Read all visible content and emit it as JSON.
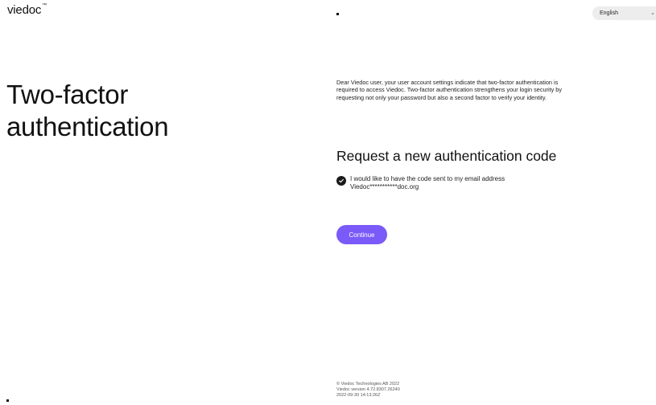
{
  "header": {
    "logo": "viedoc",
    "logo_tm": "™",
    "language": "English",
    "language_chevron": "⌄"
  },
  "hero": {
    "title_line1": "Two-factor",
    "title_line2": "authentication"
  },
  "main": {
    "intro": "Dear Viedoc user, your user account settings indicate that two-factor authentication is required to access Viedoc. Two-factor authentication strengthens your login security by requesting not only your password but also a second factor to verify your identity.",
    "heading": "Request a new authentication code",
    "option_label": "I would like to have the code sent to my email address",
    "option_email": "Viedoc***********doc.org",
    "continue_label": "Continue"
  },
  "footer": {
    "copyright": "© Viedoc Technologies AB 2022",
    "version": "Viedoc  version 4.72.8307.26240",
    "timestamp": "2022-09-30 14:13:26Z"
  },
  "colors": {
    "accent": "#7a5af8",
    "check": "#1a1a1a"
  },
  "icons": {
    "checkbox": "checkmark-circle-icon",
    "language": "chevron-down-icon"
  }
}
